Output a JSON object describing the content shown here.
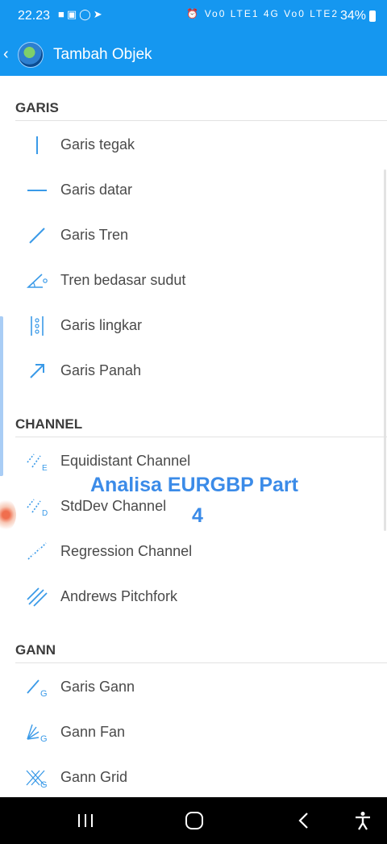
{
  "status_bar": {
    "time": "22.23",
    "left_icons": [
      "video-icon",
      "message-icon",
      "whatsapp-icon",
      "telegram-icon"
    ],
    "right_icons_text": "Vo0 LTE1 4G Vo0 LTE2",
    "battery": "34%"
  },
  "app_bar": {
    "title": "Tambah Objek"
  },
  "sections": [
    {
      "header": "GARIS",
      "items": [
        {
          "label": "Garis tegak",
          "icon": "vertical-line-icon"
        },
        {
          "label": "Garis datar",
          "icon": "horizontal-line-icon"
        },
        {
          "label": "Garis Tren",
          "icon": "trend-line-icon"
        },
        {
          "label": "Tren bedasar sudut",
          "icon": "trend-angle-icon"
        },
        {
          "label": "Garis lingkar",
          "icon": "cycle-lines-icon"
        },
        {
          "label": "Garis Panah",
          "icon": "arrow-line-icon"
        }
      ]
    },
    {
      "header": "CHANNEL",
      "items": [
        {
          "label": "Equidistant Channel",
          "icon": "equidistant-channel-icon"
        },
        {
          "label": "StdDev Channel",
          "icon": "stddev-channel-icon"
        },
        {
          "label": "Regression Channel",
          "icon": "regression-channel-icon"
        },
        {
          "label": "Andrews Pitchfork",
          "icon": "pitchfork-icon"
        }
      ]
    },
    {
      "header": "GANN",
      "items": [
        {
          "label": "Garis Gann",
          "icon": "gann-line-icon"
        },
        {
          "label": "Gann Fan",
          "icon": "gann-fan-icon"
        },
        {
          "label": "Gann Grid",
          "icon": "gann-grid-icon"
        }
      ]
    }
  ],
  "overlay": {
    "title": "Analisa EURGBP Part",
    "sub": "4"
  },
  "colors": {
    "accent": "#1597f0",
    "icon": "#3a9ae8",
    "overlay_text": "#3b8be8"
  }
}
